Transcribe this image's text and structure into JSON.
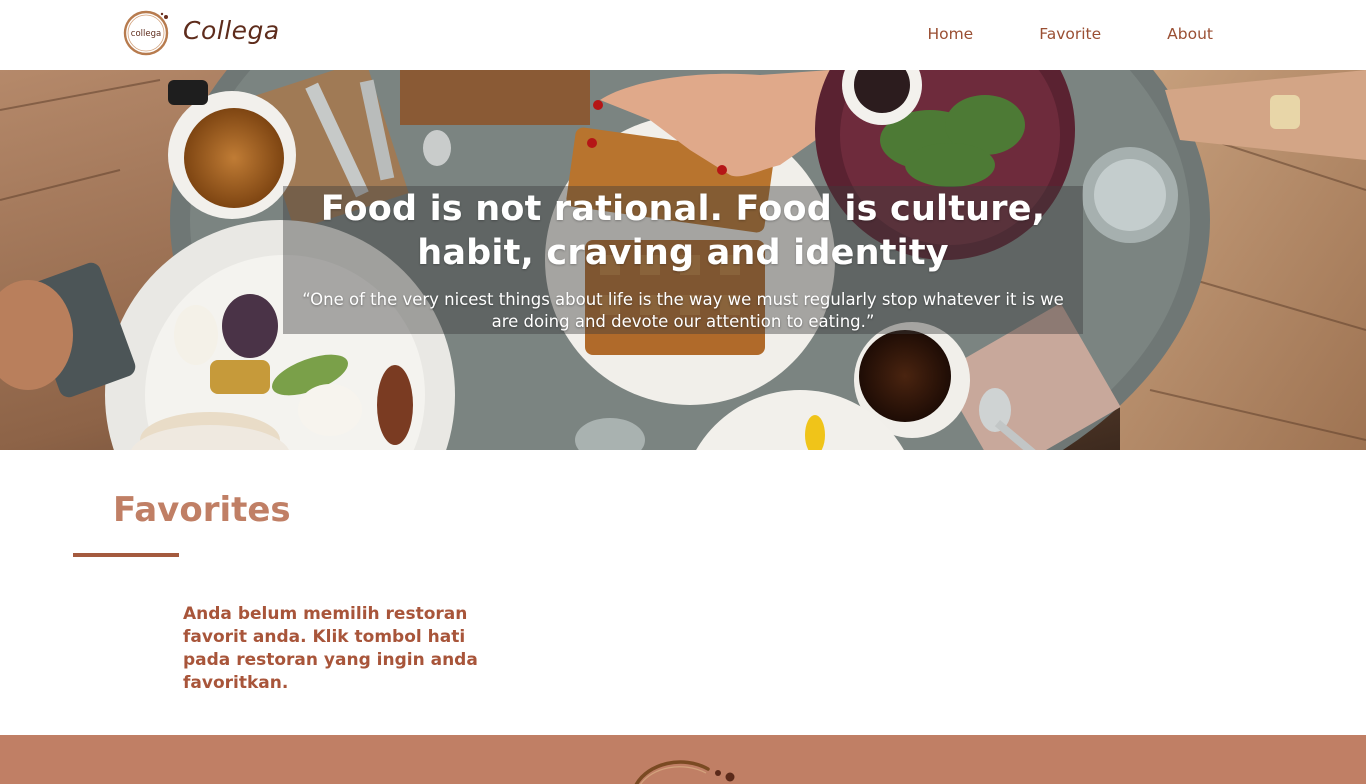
{
  "header": {
    "brand": "Collega",
    "logo_text": "collega",
    "nav": [
      {
        "label": "Home"
      },
      {
        "label": "Favorite"
      },
      {
        "label": "About"
      }
    ]
  },
  "hero": {
    "title": "Food is not rational. Food is culture, habit, craving and identity",
    "quote": "“One of the very nicest things about life is the way we must regularly stop whatever it is we are doing and devote our attention to eating.”"
  },
  "favorites": {
    "heading": "Favorites",
    "empty_message": "Anda belum memilih restoran favorit anda. Klik tombol hati pada restoran yang ingin anda favoritkan."
  },
  "colors": {
    "accent": "#c07f65",
    "brand_dark": "#5e2c1c",
    "text_brown": "#a8553a"
  }
}
